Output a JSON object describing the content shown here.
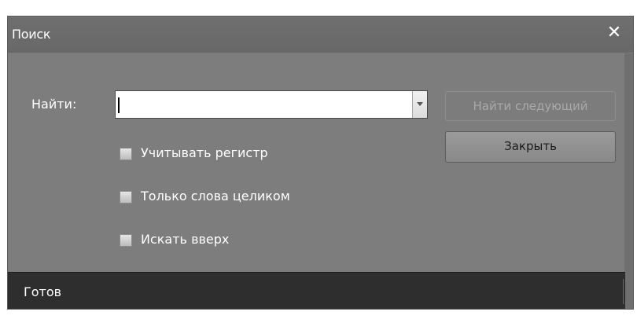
{
  "window": {
    "title": "Поиск",
    "close_symbol": "✕"
  },
  "find": {
    "label": "Найти:",
    "value": "",
    "dropdown_icon": "chevron-down-icon"
  },
  "buttons": {
    "find_next": "Найти следующий",
    "close": "Закрыть"
  },
  "options": [
    {
      "label": "Учитывать регистр",
      "checked": false
    },
    {
      "label": "Только слова целиком",
      "checked": false
    },
    {
      "label": "Искать вверх",
      "checked": false
    }
  ],
  "status": {
    "text": "Готов"
  },
  "colors": {
    "dialog_bg": "#7d7d7d",
    "status_bg": "#2e2e2e",
    "text": "#ffffff",
    "disabled_text": "#a9a9a9"
  }
}
